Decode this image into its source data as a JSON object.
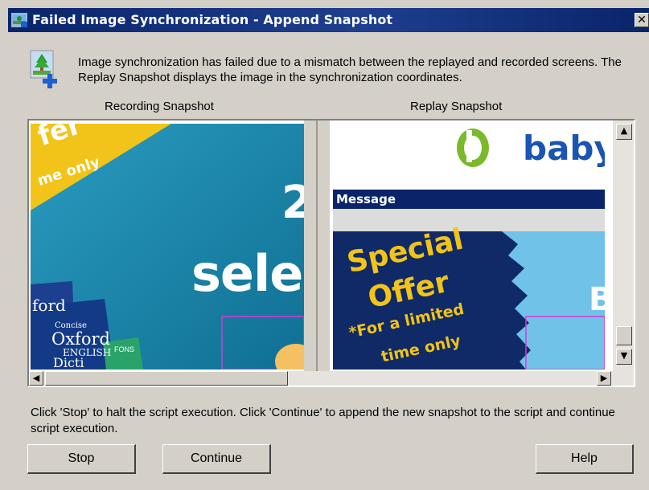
{
  "window": {
    "title": "Failed Image Synchronization - Append Snapshot",
    "close_glyph": "✕"
  },
  "message": "Image synchronization has failed due to a mismatch between the replayed and recorded screens.  The Replay Snapshot displays the image in the synchronization coordinates.",
  "labels": {
    "recording": "Recording Snapshot",
    "replay": "Replay Snapshot"
  },
  "recording_image": {
    "offer_fragment": "fer",
    "offer_sub": "me only",
    "big_digit": "2",
    "big_word": "sele",
    "book_ford": "ford",
    "book_concise": "Concise",
    "book_oxford": "Oxford",
    "book_english": "ENGLISH",
    "book_dict": "Dicti",
    "book_green": "FONS"
  },
  "replay_image": {
    "logo_text": "baby",
    "message_bar": "Message",
    "special": "Special",
    "offer": "Offer",
    "limited": "*For a limited",
    "time_only": "time only",
    "right_letter": "B"
  },
  "icons": {
    "title": "app-icon",
    "message": "image-sync-icon",
    "scroll_up": "▲",
    "scroll_down": "▼",
    "scroll_left": "◀",
    "scroll_right": "▶"
  },
  "instructions": "Click 'Stop' to halt the script execution. Click 'Continue' to append the new snapshot to the script and continue script execution.",
  "buttons": {
    "stop": "Stop",
    "continue": "Continue",
    "help": "Help"
  },
  "colors": {
    "title_bar": "#0a246a",
    "dialog_bg": "#d4d0c8",
    "recording_bg": "#1e8fb0",
    "offer_yellow": "#f2c318",
    "baby_green": "#7ab929",
    "baby_blue": "#1b55b3",
    "message_bar": "#0a246a",
    "selection_magenta": "#d53bd5"
  }
}
